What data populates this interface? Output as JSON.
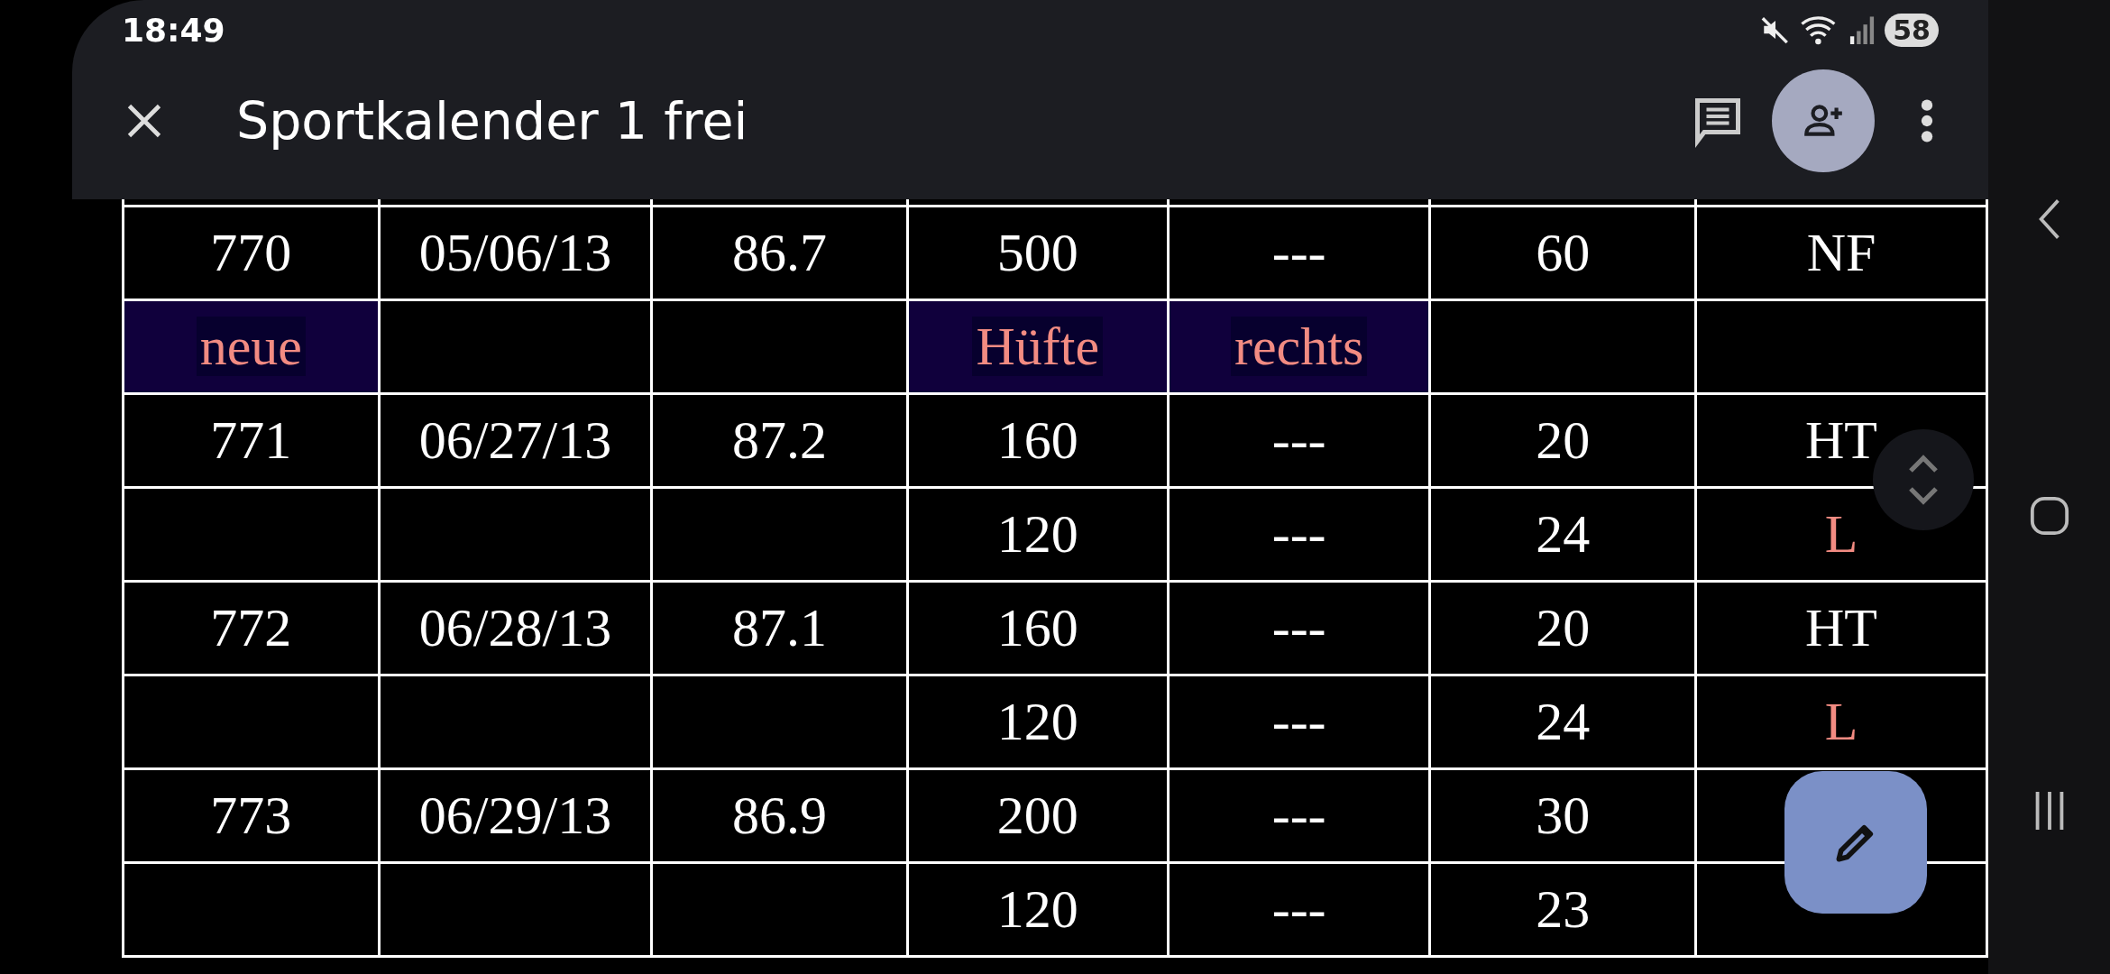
{
  "status_bar": {
    "time": "18:49",
    "battery": "58"
  },
  "toolbar": {
    "title": "Sportkalender 1 frei"
  },
  "table": {
    "rows": [
      {
        "cells": [
          {
            "text": "770"
          },
          {
            "text": "05/06/13"
          },
          {
            "text": "86.7"
          },
          {
            "text": "500"
          },
          {
            "text": "---"
          },
          {
            "text": "60"
          },
          {
            "text": "NF"
          }
        ]
      },
      {
        "cells": [
          {
            "text": "neue",
            "color": "#f28b82",
            "highlight": true
          },
          {
            "text": ""
          },
          {
            "text": ""
          },
          {
            "text": "Hüfte",
            "color": "#f28b82",
            "highlight": true
          },
          {
            "text": "rechts",
            "color": "#f28b82",
            "highlight": true
          },
          {
            "text": ""
          },
          {
            "text": ""
          }
        ]
      },
      {
        "cells": [
          {
            "text": "771"
          },
          {
            "text": "06/27/13"
          },
          {
            "text": "87.2"
          },
          {
            "text": "160"
          },
          {
            "text": "---"
          },
          {
            "text": "20"
          },
          {
            "text": "HT"
          }
        ]
      },
      {
        "cells": [
          {
            "text": ""
          },
          {
            "text": ""
          },
          {
            "text": ""
          },
          {
            "text": "120"
          },
          {
            "text": "---"
          },
          {
            "text": "24"
          },
          {
            "text": "L",
            "color": "#f28b82"
          }
        ]
      },
      {
        "cells": [
          {
            "text": "772"
          },
          {
            "text": "06/28/13"
          },
          {
            "text": "87.1"
          },
          {
            "text": "160"
          },
          {
            "text": "---"
          },
          {
            "text": "20"
          },
          {
            "text": "HT"
          }
        ]
      },
      {
        "cells": [
          {
            "text": ""
          },
          {
            "text": ""
          },
          {
            "text": ""
          },
          {
            "text": "120"
          },
          {
            "text": "---"
          },
          {
            "text": "24"
          },
          {
            "text": "L",
            "color": "#f28b82"
          }
        ]
      },
      {
        "cells": [
          {
            "text": "773"
          },
          {
            "text": "06/29/13"
          },
          {
            "text": "86.9"
          },
          {
            "text": "200"
          },
          {
            "text": "---"
          },
          {
            "text": "30"
          },
          {
            "text": ""
          }
        ]
      },
      {
        "cells": [
          {
            "text": ""
          },
          {
            "text": ""
          },
          {
            "text": ""
          },
          {
            "text": "120"
          },
          {
            "text": "---"
          },
          {
            "text": "23"
          },
          {
            "text": ""
          }
        ]
      }
    ]
  }
}
